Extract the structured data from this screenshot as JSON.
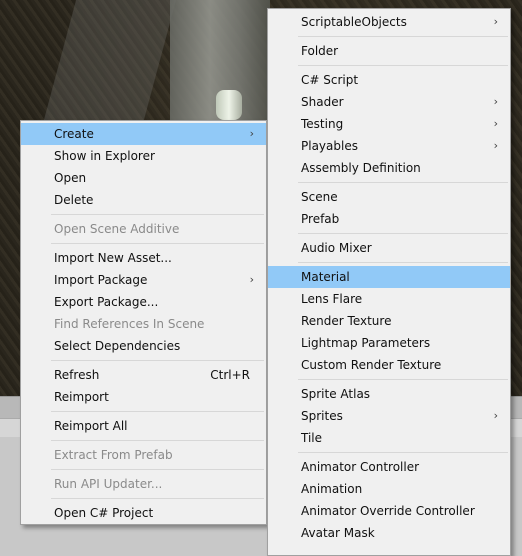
{
  "left_menu": {
    "items": [
      {
        "label": "Create",
        "arrow": "›",
        "highlight": true
      },
      {
        "label": "Show in Explorer"
      },
      {
        "label": "Open"
      },
      {
        "label": "Delete"
      },
      {
        "sep": true
      },
      {
        "label": "Open Scene Additive",
        "disabled": true
      },
      {
        "sep": true
      },
      {
        "label": "Import New Asset..."
      },
      {
        "label": "Import Package",
        "arrow": "›"
      },
      {
        "label": "Export Package..."
      },
      {
        "label": "Find References In Scene",
        "disabled": true
      },
      {
        "label": "Select Dependencies"
      },
      {
        "sep": true
      },
      {
        "label": "Refresh",
        "shortcut": "Ctrl+R"
      },
      {
        "label": "Reimport"
      },
      {
        "sep": true
      },
      {
        "label": "Reimport All"
      },
      {
        "sep": true
      },
      {
        "label": "Extract From Prefab",
        "disabled": true
      },
      {
        "sep": true
      },
      {
        "label": "Run API Updater...",
        "disabled": true
      },
      {
        "sep": true
      },
      {
        "label": "Open C# Project"
      }
    ]
  },
  "right_menu": {
    "items": [
      {
        "label": "ScriptableObjects",
        "arrow": "›"
      },
      {
        "sep": true
      },
      {
        "label": "Folder"
      },
      {
        "sep": true
      },
      {
        "label": "C# Script"
      },
      {
        "label": "Shader",
        "arrow": "›"
      },
      {
        "label": "Testing",
        "arrow": "›"
      },
      {
        "label": "Playables",
        "arrow": "›"
      },
      {
        "label": "Assembly Definition"
      },
      {
        "sep": true
      },
      {
        "label": "Scene"
      },
      {
        "label": "Prefab"
      },
      {
        "sep": true
      },
      {
        "label": "Audio Mixer"
      },
      {
        "sep": true
      },
      {
        "label": "Material",
        "highlight": true
      },
      {
        "label": "Lens Flare"
      },
      {
        "label": "Render Texture"
      },
      {
        "label": "Lightmap Parameters"
      },
      {
        "label": "Custom Render Texture"
      },
      {
        "sep": true
      },
      {
        "label": "Sprite Atlas"
      },
      {
        "label": "Sprites",
        "arrow": "›"
      },
      {
        "label": "Tile"
      },
      {
        "sep": true
      },
      {
        "label": "Animator Controller"
      },
      {
        "label": "Animation"
      },
      {
        "label": "Animator Override Controller"
      },
      {
        "label": "Avatar Mask"
      }
    ]
  },
  "colors": {
    "menu_bg": "#f0f0f0",
    "highlight": "#91c9f7",
    "disabled_text": "#8a8a8a"
  }
}
